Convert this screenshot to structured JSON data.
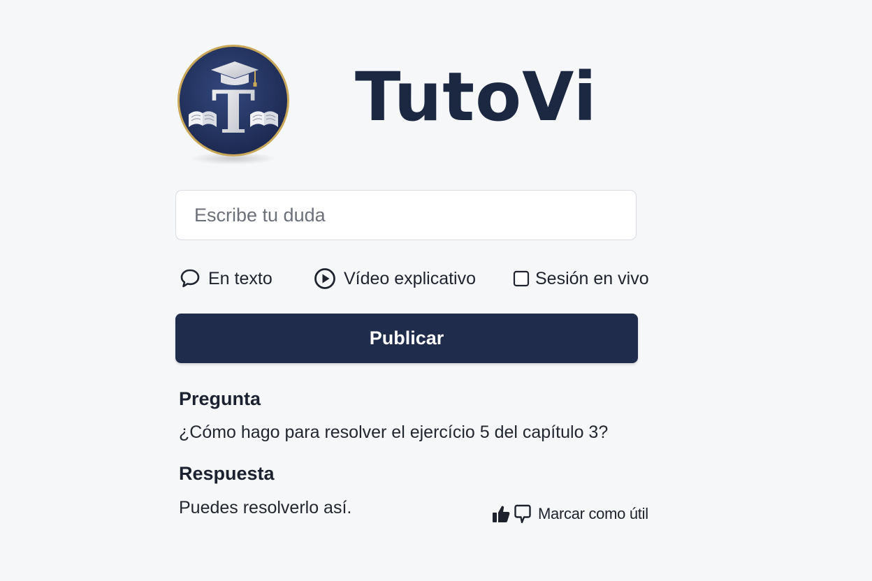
{
  "app": {
    "brand_name": "TutoVi",
    "logo_letter": "T",
    "logo_icon": "graduation-cap-books-icon"
  },
  "question_input": {
    "placeholder": "Escribe tu duda",
    "value": ""
  },
  "response_options": [
    {
      "label": "En texto",
      "icon": "speech-bubble-icon"
    },
    {
      "label": "Vídeo explicativo",
      "icon": "play-circle-icon"
    },
    {
      "label": "Sesión en vivo",
      "icon": "checkbox-icon",
      "checked": false
    }
  ],
  "publish_button": {
    "label": "Publicar"
  },
  "question": {
    "heading": "Pregunta",
    "text": "¿Cómo hago para resolver el ejercício 5 del capítulo 3?"
  },
  "answer": {
    "heading": "Respuesta",
    "text": "Puedes resolverlo así.",
    "mark_useful_label": "Marcar como útil"
  },
  "colors": {
    "brand_navy": "#1f2c4b",
    "logo_gold": "#c9a85a",
    "background": "#f6f7f8"
  }
}
